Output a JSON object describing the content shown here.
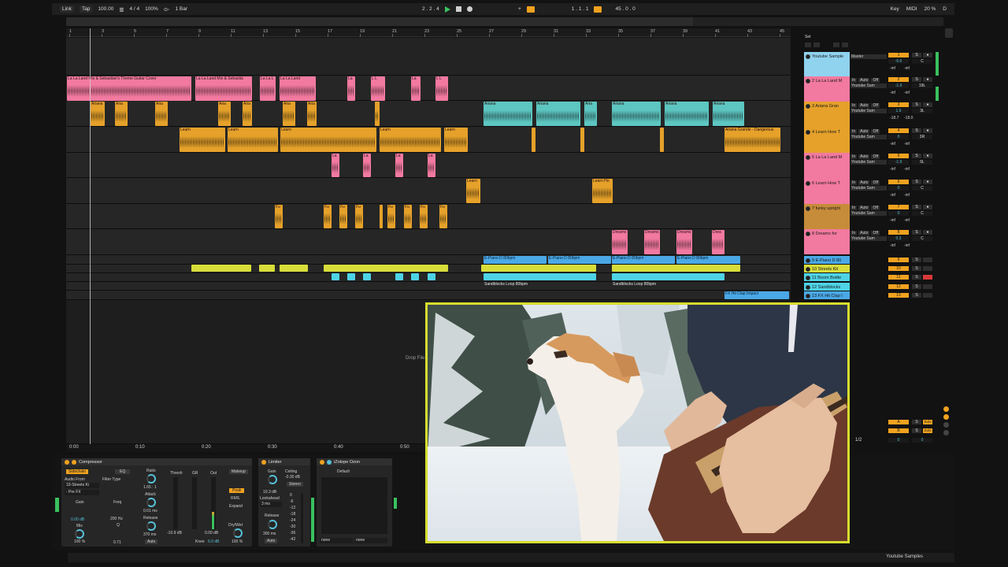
{
  "transport": {
    "link": "Link",
    "tap": "Tap",
    "tempo": "100.00",
    "time_sig": "4 / 4",
    "zoom": "100%",
    "quantize": "1 Bar",
    "position": "2 . 2 . 4",
    "loop_start": "1 . 1 . 1",
    "loop_length": "45 . 0 . 0",
    "key": "Key",
    "midi": "MIDI",
    "cpu": "20 %",
    "d": "D"
  },
  "ruler": [
    "1",
    "3",
    "5",
    "7",
    "9",
    "11",
    "13",
    "15",
    "17",
    "19",
    "21",
    "23",
    "25",
    "27",
    "29",
    "31",
    "33",
    "35",
    "37",
    "39",
    "41",
    "43",
    "45"
  ],
  "set_label": "Set",
  "timeline": [
    "0:00",
    "0:10",
    "0:20",
    "0:30",
    "0:40",
    "0:50"
  ],
  "drop_files": "Drop File",
  "clips": {
    "pink1": "La La Land Mix & Sebastian's Theme Guitar Cover",
    "pink2": "La La Land Mix & Sebastia",
    "pink3": "La La L",
    "pink4": "La La Land",
    "pink5": "La",
    "pink6": "L L",
    "ariana": "Ariana",
    "ariana2": "Aria",
    "learn": "Learn",
    "learn2": "Learn Ho",
    "ariana_long": "Ariana Grande - Dangerous",
    "la": "La",
    "fu": "Fu",
    "dreams": "Dreams",
    "dreams2": "Drea",
    "epiano1": "E-Piano D 80bpm",
    "epiano2": "E-Piano D 80bpm",
    "epiano3": "E-Piano D 80bpm",
    "epiano4": "E-Piano D 80bpm",
    "sand1": "Sandblocks Loop 80bpm",
    "sand2": "Sandblocks Loop 80bpm",
    "fx": "FX Hit Clap Impact"
  },
  "tracks": [
    {
      "name": "Youtube Sample",
      "io": "Master",
      "num": "1",
      "vol": "-5.6",
      "pan": "C",
      "inf1": "-inf",
      "inf2": "-inf"
    },
    {
      "name": "2 La La Land M",
      "io": "Youtube Sam",
      "num": "2",
      "vol": "-1.9",
      "pan": "19L",
      "inf1": "-inf",
      "inf2": "-inf"
    },
    {
      "name": "3 Ariana Gran",
      "io": "Youtube Sam",
      "num": "3",
      "vol": "1.9",
      "pan": "3L",
      "inf1": "-18.7",
      "inf2": "-18.0"
    },
    {
      "name": "4 Learn How T",
      "io": "Youtube Sam",
      "num": "4",
      "vol": "0",
      "pan": "3R",
      "inf1": "-inf",
      "inf2": "-inf"
    },
    {
      "name": "5 La La Land M",
      "io": "Youtube Sam",
      "num": "5",
      "vol": "-1.9",
      "pan": "6L",
      "inf1": "-inf",
      "inf2": "-inf"
    },
    {
      "name": "6 Learn How T",
      "io": "Youtube Sam",
      "num": "6",
      "vol": "0",
      "pan": "C",
      "inf1": "-inf",
      "inf2": "-inf"
    },
    {
      "name": "7 funky upright",
      "io": "Youtube Sam",
      "num": "7",
      "vol": "0",
      "pan": "C",
      "inf1": "-inf",
      "inf2": "-inf"
    },
    {
      "name": "8 Dreams for",
      "io": "Youtube Sam",
      "num": "8",
      "vol": "0.3",
      "pan": "C",
      "inf1": "-inf",
      "inf2": "-inf"
    }
  ],
  "small_tracks": [
    {
      "name": "9 E-Piano D 80",
      "num": "9"
    },
    {
      "name": "10 Streets Kit",
      "num": "10"
    },
    {
      "name": "11 Boom Bottle",
      "num": "11"
    },
    {
      "name": "12 Sandblocks",
      "num": "12"
    },
    {
      "name": "13 FX Hit Clap I",
      "num": "13"
    }
  ],
  "returns": [
    {
      "num": "A"
    },
    {
      "num": "B"
    }
  ],
  "master": {
    "ratio_label": "1/2",
    "vol": "0",
    "pan": "0"
  },
  "labels": {
    "s": "S",
    "auto": "Auto",
    "in": "In",
    "off": "Off",
    "solo": "Solo",
    "c": "C"
  },
  "compressor": {
    "title": "Compressor",
    "sidechain": "Sidechain",
    "eq": "EQ",
    "audio_from": "Audio From",
    "source": "10-Streets Ki",
    "pre_fx": "- Pre FX",
    "filter_type": "Filter Type",
    "gain_label": "Gain",
    "gain": "0.00 dB",
    "freq_label": "Freq",
    "freq": "200 Hz",
    "mix_label": "Mix",
    "mix": "100 %",
    "q_label": "Q",
    "q": "0.71",
    "ratio_label": "Ratio",
    "ratio": "1.65 : 1",
    "attack_label": "Attack",
    "attack": "0.01 ms",
    "release_label": "Release",
    "release": "370 ms",
    "auto": "Auto",
    "thresh": "Thresh",
    "gr": "GR",
    "out": "Out",
    "thresh_val": "-10.9 dB",
    "out_val": "0.00 dB",
    "makeup": "Makeup",
    "peak": "Peak",
    "rms": "RMS",
    "expand": "Expand",
    "knee_label": "Knee",
    "knee": "6.0 dB",
    "drywet": "Dry/Wet",
    "drywet_val": "100 %"
  },
  "limiter": {
    "title": "Limiter",
    "gain_label": "Gain",
    "gain": "10.3 dB",
    "ceiling_label": "Ceiling",
    "ceiling": "-0.30 dB",
    "stereo": "Stereo",
    "lookahead_label": "Lookahead",
    "lookahead": "3 ms",
    "release_label": "Release",
    "release": "300 ms",
    "auto": "Auto",
    "scale": [
      "0",
      "-6",
      "-12",
      "-18",
      "-24",
      "-30",
      "-36",
      "-42"
    ]
  },
  "ozone": {
    "title": "iZotope Ozon",
    "preset": "Default",
    "in": "none",
    "out": "none"
  },
  "status": {
    "right": "Youtube Samples"
  },
  "colors": {
    "pink": "#f279a0",
    "orange": "#e5a12a",
    "teal": "#5dc6c1",
    "yellow": "#d8dd3a",
    "cyan": "#4ed3e6",
    "blue": "#4aa8e6",
    "accent": "#f0a21f",
    "frame": "#d6dd2e"
  }
}
